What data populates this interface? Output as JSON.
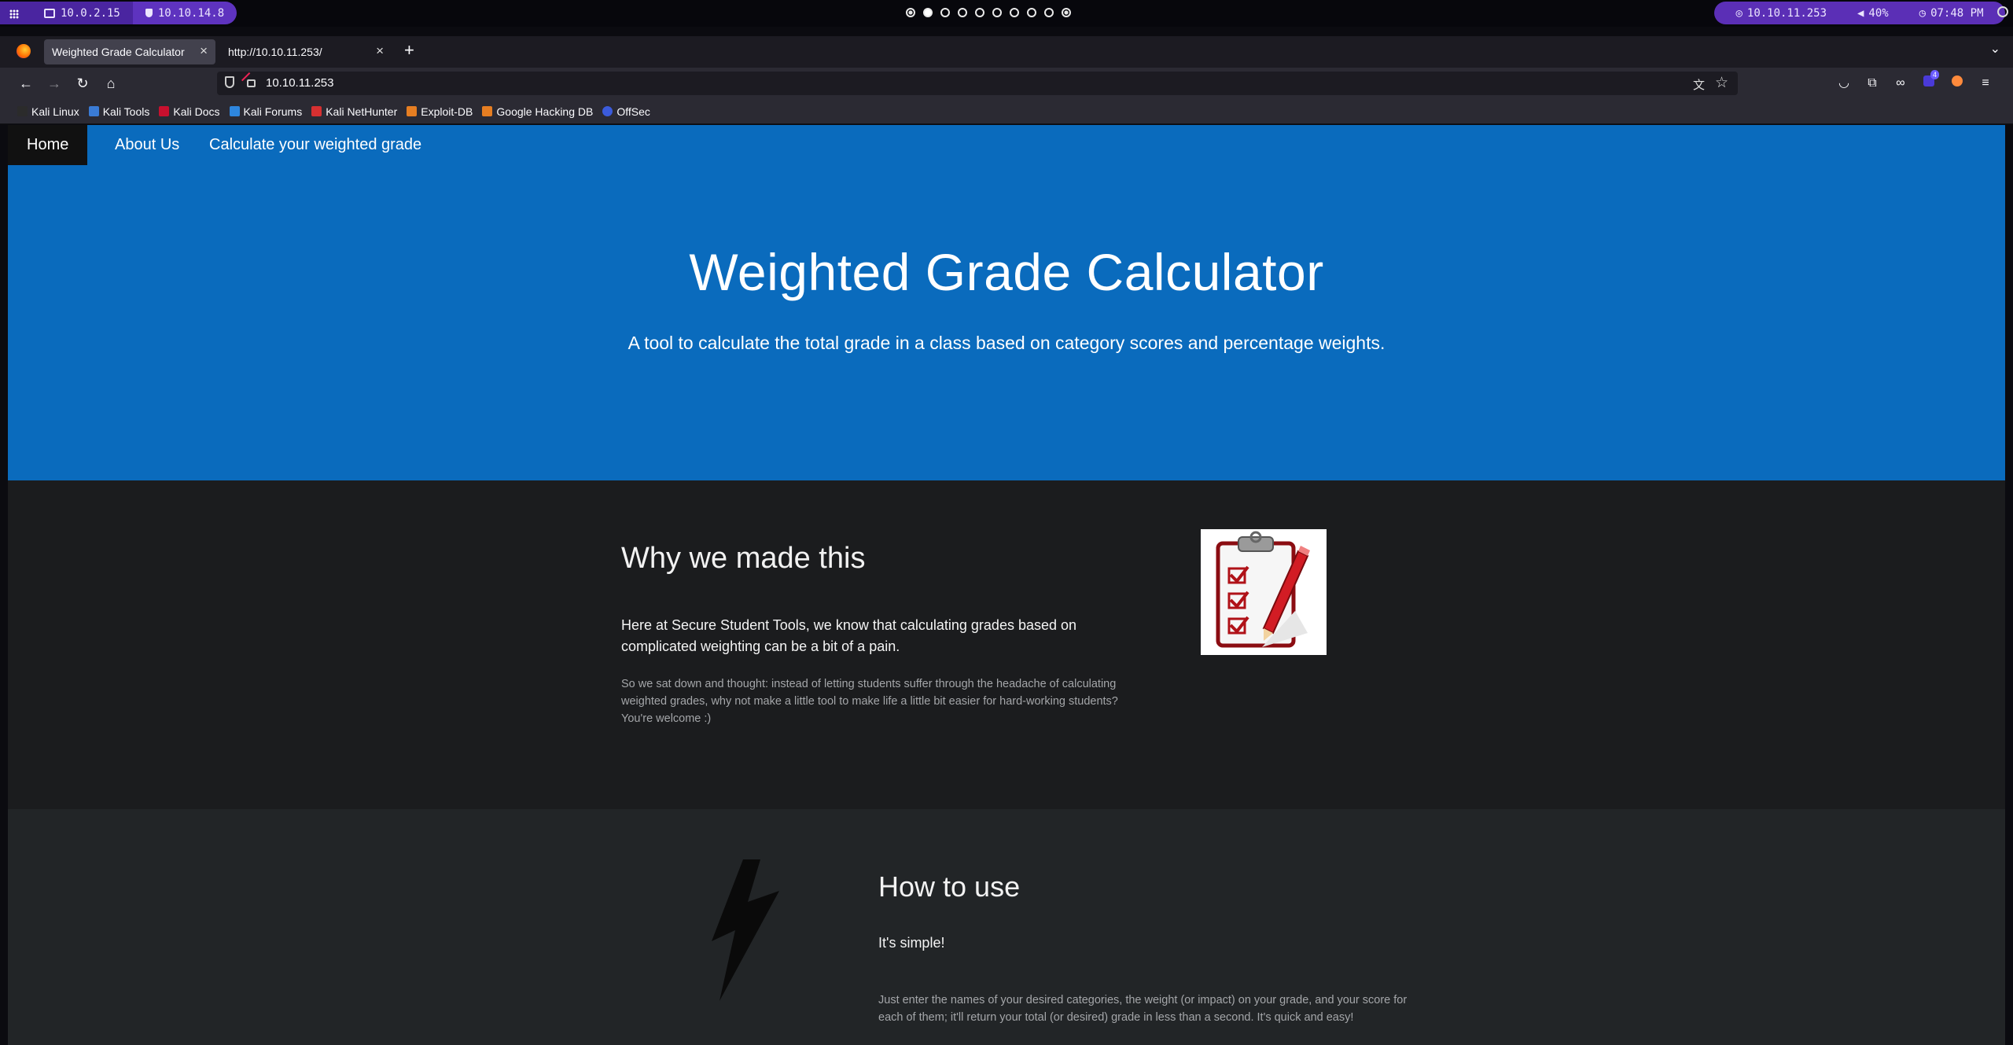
{
  "system_bar": {
    "workspaces": [
      "10.0.2.15",
      "10.10.14.8"
    ],
    "target_ip": "10.10.11.253",
    "volume": "40%",
    "time": "07:48 PM"
  },
  "browser": {
    "tabs": [
      {
        "label": "Weighted Grade Calculator"
      },
      {
        "label": "http://10.10.11.253/"
      }
    ],
    "url": "10.10.11.253",
    "bookmarks": [
      {
        "label": "Kali Linux",
        "color": "#2b2b2b"
      },
      {
        "label": "Kali Tools",
        "color": "#3a7bd5"
      },
      {
        "label": "Kali Docs",
        "color": "#c8102e"
      },
      {
        "label": "Kali Forums",
        "color": "#2e86de"
      },
      {
        "label": "Kali NetHunter",
        "color": "#d63031"
      },
      {
        "label": "Exploit-DB",
        "color": "#e67e22"
      },
      {
        "label": "Google Hacking DB",
        "color": "#e67e22"
      },
      {
        "label": "OffSec",
        "color": "#3b5bdb"
      }
    ],
    "extension_badge": "4"
  },
  "site": {
    "nav": {
      "home": "Home",
      "about": "About Us",
      "calc": "Calculate your weighted grade"
    },
    "hero": {
      "title": "Weighted Grade Calculator",
      "subtitle": "A tool to calculate the total grade in a class based on category scores and percentage weights."
    },
    "why": {
      "title": "Why we made this",
      "lead": "Here at Secure Student Tools, we know that calculating grades based on complicated weighting can be a bit of a pain.",
      "body": "So we sat down and thought: instead of letting students suffer through the headache of calculating weighted grades, why not make a little tool to make life a little bit easier for hard-working students? You're welcome :)"
    },
    "how": {
      "title": "How to use",
      "lead": "It's simple!",
      "body": "Just enter the names of your desired categories, the weight (or impact) on your grade, and your score for each of them; it'll return your total (or desired) grade in less than a second. It's quick and easy!"
    },
    "colors": {
      "primary": "#0a6bbd",
      "nav_active": "#111111",
      "dark_section": "#1b1c1e",
      "darker_section": "#222527"
    }
  }
}
